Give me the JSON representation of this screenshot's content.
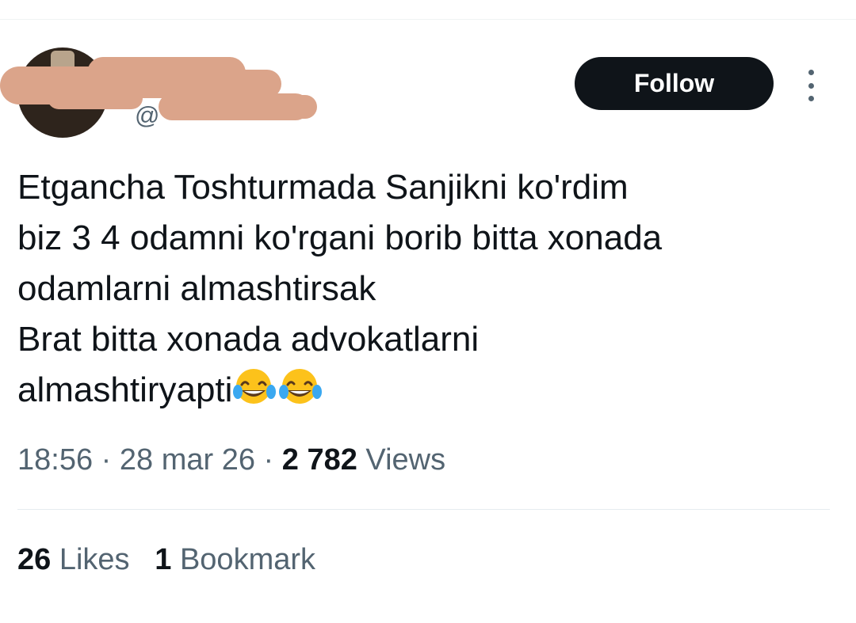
{
  "author": {
    "name": "",
    "handle": "@"
  },
  "follow_label": "Follow",
  "tweet": {
    "text": "Etgancha Toshturmada Sanjikni ko'rdim\nbiz 3 4 odamni ko'rgani borib bitta xonada\nodamlarni almashtirsak\nBrat bitta xonada advokatlarni\nalmashtiryapti",
    "emoji_icon": "face-with-tears-of-joy-icon"
  },
  "meta": {
    "time": "18:56",
    "separator": "·",
    "date": "28 mar 26",
    "views_count": "2 782",
    "views_label": "Views"
  },
  "stats": {
    "likes_count": "26",
    "likes_label": "Likes",
    "bookmarks_count": "1",
    "bookmarks_label": "Bookmark"
  },
  "colors": {
    "text_primary": "#0f1419",
    "text_secondary": "#536471",
    "follow_bg": "#0f1419",
    "redaction": "#dba48a"
  }
}
